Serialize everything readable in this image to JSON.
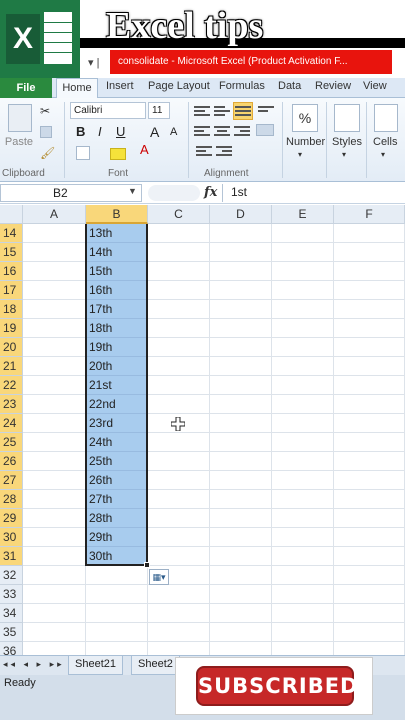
{
  "banner": {
    "title": "Excel tips",
    "window_title": "consolidate - Microsoft Excel (Product Activation F..."
  },
  "ribbon": {
    "tabs": [
      "File",
      "Home",
      "Insert",
      "Page Layout",
      "Formulas",
      "Data",
      "Review",
      "View"
    ],
    "font_name": "Calibri",
    "font_size": "11",
    "paste_label": "Paste",
    "clipboard_label": "Clipboard",
    "font_label": "Font",
    "alignment_label": "Alignment",
    "number_label": "Number",
    "styles_label": "Styles",
    "cells_label": "Cells",
    "percent_symbol": "%",
    "bold": "B",
    "italic": "I",
    "underline": "U",
    "grow_font": "A",
    "shrink_font": "A",
    "font_color_letter": "A"
  },
  "formula_bar": {
    "name_box": "B2",
    "fx": "fx",
    "value": "1st"
  },
  "grid": {
    "columns": [
      "A",
      "B",
      "C",
      "D",
      "E",
      "F"
    ],
    "selected_column": "B",
    "rows": [
      {
        "num": "14",
        "b": "13th"
      },
      {
        "num": "15",
        "b": "14th"
      },
      {
        "num": "16",
        "b": "15th"
      },
      {
        "num": "17",
        "b": "16th"
      },
      {
        "num": "18",
        "b": "17th"
      },
      {
        "num": "19",
        "b": "18th"
      },
      {
        "num": "20",
        "b": "19th"
      },
      {
        "num": "21",
        "b": "20th"
      },
      {
        "num": "22",
        "b": "21st"
      },
      {
        "num": "23",
        "b": "22nd"
      },
      {
        "num": "24",
        "b": "23rd"
      },
      {
        "num": "25",
        "b": "24th"
      },
      {
        "num": "26",
        "b": "25th"
      },
      {
        "num": "27",
        "b": "26th"
      },
      {
        "num": "28",
        "b": "27th"
      },
      {
        "num": "29",
        "b": "28th"
      },
      {
        "num": "30",
        "b": "29th"
      },
      {
        "num": "31",
        "b": "30th"
      },
      {
        "num": "32",
        "b": ""
      },
      {
        "num": "33",
        "b": ""
      },
      {
        "num": "34",
        "b": ""
      },
      {
        "num": "35",
        "b": ""
      },
      {
        "num": "36",
        "b": ""
      }
    ]
  },
  "sheet_tabs": [
    "Sheet21",
    "Sheet2"
  ],
  "status": "Ready",
  "overlay": {
    "subscribed_label": "SUBSCRIBED"
  },
  "colors": {
    "excel_green": "#1f7a45",
    "selection_blue": "#a8ccee",
    "header_highlight": "#f9d77a",
    "banner_red": "#e8140d",
    "subscribe_red": "#c62828"
  }
}
